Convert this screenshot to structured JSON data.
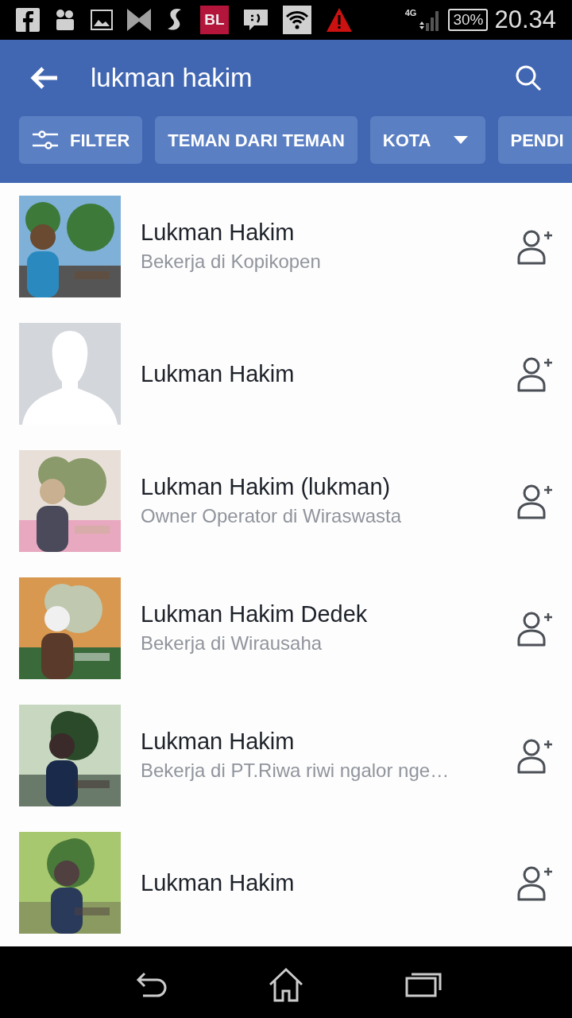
{
  "status_bar": {
    "app_badge": "BL",
    "network": "4G",
    "battery": "30%",
    "time": "20.34"
  },
  "search_bar": {
    "query": "lukman hakim"
  },
  "filters": [
    {
      "kind": "filter",
      "label": "FILTER"
    },
    {
      "kind": "plain",
      "label": "TEMAN DARI TEMAN"
    },
    {
      "kind": "dropdown",
      "label": "KOTA"
    },
    {
      "kind": "plain",
      "label": "PENDI"
    }
  ],
  "results": [
    {
      "kind": "picture",
      "name": "Lukman Hakim",
      "subtitle": "Bekerja di Kopikopen"
    },
    {
      "kind": "placeholder",
      "name": "Lukman Hakim"
    },
    {
      "kind": "picture",
      "name": "Lukman Hakim (lukman)",
      "subtitle": "Owner Operator di Wiraswasta"
    },
    {
      "kind": "picture",
      "name": "Lukman Hakim Dedek",
      "subtitle": "Bekerja di Wirausaha"
    },
    {
      "kind": "picture",
      "name": "Lukman Hakim",
      "subtitle": "Bekerja di PT.Riwa riwi ngalor nge…"
    },
    {
      "kind": "picture",
      "name": "Lukman Hakim"
    }
  ]
}
